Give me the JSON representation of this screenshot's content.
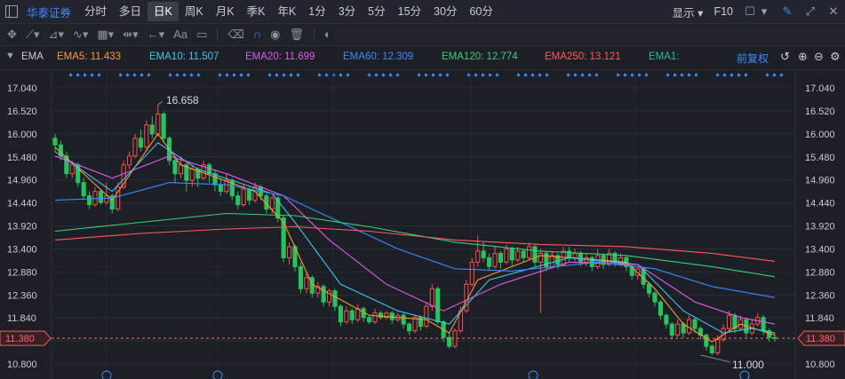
{
  "topbar": {
    "brand": "华泰证券",
    "periods": [
      "分时",
      "多日",
      "日K",
      "周K",
      "月K",
      "季K",
      "年K",
      "1分",
      "3分",
      "5分",
      "15分",
      "30分",
      "60分"
    ],
    "active_period": "日K",
    "display_label": "显示",
    "f10_label": "F10"
  },
  "toolbar": {
    "font_label": "Aa"
  },
  "ema_bar": {
    "indicator": "EMA",
    "adjust_label": "前复权",
    "items": [
      {
        "label": "EMA5: 11.433",
        "color": "#ff9a2e"
      },
      {
        "label": "EMA10: 11.507",
        "color": "#3fc6f0"
      },
      {
        "label": "EMA20: 11.699",
        "color": "#e05ce6"
      },
      {
        "label": "EMA60: 12.309",
        "color": "#3a8cff"
      },
      {
        "label": "EMA120: 12.774",
        "color": "#3ad07a"
      },
      {
        "label": "EMA250: 13.121",
        "color": "#ff5a5a"
      },
      {
        "label": "EMA1:",
        "color": "#1ec0a8"
      }
    ]
  },
  "chart_data": {
    "type": "candlestick",
    "y_ticks": [
      "17.040",
      "16.520",
      "16.000",
      "15.480",
      "14.960",
      "14.440",
      "13.920",
      "13.400",
      "12.880",
      "12.360",
      "11.840",
      "11.320",
      "10.800"
    ],
    "ylim": [
      10.8,
      17.04
    ],
    "current_price": "11.380",
    "high_label": "16.658",
    "low_label": "11.000",
    "grid": true,
    "candles": [
      [
        15.9,
        15.75,
        16.0,
        15.6
      ],
      [
        15.75,
        15.5,
        15.85,
        15.4
      ],
      [
        15.5,
        15.1,
        15.6,
        15.0
      ],
      [
        15.1,
        15.3,
        15.4,
        15.0
      ],
      [
        15.3,
        14.9,
        15.35,
        14.8
      ],
      [
        14.9,
        14.6,
        15.0,
        14.5
      ],
      [
        14.6,
        14.4,
        14.7,
        14.3
      ],
      [
        14.4,
        14.7,
        14.8,
        14.35
      ],
      [
        14.7,
        14.45,
        14.75,
        14.4
      ],
      [
        14.45,
        14.6,
        14.9,
        14.4
      ],
      [
        14.6,
        14.3,
        14.65,
        14.2
      ],
      [
        14.3,
        14.8,
        14.9,
        14.25
      ],
      [
        14.8,
        15.3,
        15.4,
        14.75
      ],
      [
        15.3,
        15.5,
        15.6,
        15.2
      ],
      [
        15.5,
        15.9,
        16.0,
        15.45
      ],
      [
        15.9,
        15.7,
        16.1,
        15.6
      ],
      [
        15.7,
        16.2,
        16.3,
        15.65
      ],
      [
        16.2,
        16.0,
        16.4,
        15.9
      ],
      [
        16.0,
        16.45,
        16.658,
        15.95
      ],
      [
        16.45,
        15.9,
        16.5,
        15.8
      ],
      [
        15.9,
        15.4,
        15.95,
        15.3
      ],
      [
        15.4,
        15.1,
        15.5,
        14.9
      ],
      [
        15.1,
        15.3,
        15.5,
        15.0
      ],
      [
        15.3,
        14.95,
        15.35,
        14.7
      ],
      [
        14.95,
        15.2,
        15.3,
        14.8
      ],
      [
        15.2,
        15.0,
        15.25,
        14.8
      ],
      [
        15.0,
        15.3,
        15.4,
        14.95
      ],
      [
        15.3,
        15.1,
        15.35,
        14.9
      ],
      [
        15.1,
        14.85,
        15.2,
        14.7
      ],
      [
        14.85,
        14.7,
        15.0,
        14.6
      ],
      [
        14.7,
        14.95,
        15.1,
        14.65
      ],
      [
        14.95,
        14.6,
        15.0,
        14.5
      ],
      [
        14.6,
        14.4,
        14.7,
        14.3
      ],
      [
        14.4,
        14.75,
        14.85,
        14.35
      ],
      [
        14.75,
        14.5,
        14.8,
        14.4
      ],
      [
        14.5,
        14.8,
        14.9,
        14.45
      ],
      [
        14.8,
        14.6,
        14.85,
        14.5
      ],
      [
        14.6,
        14.3,
        14.65,
        14.2
      ],
      [
        14.3,
        14.55,
        14.6,
        14.2
      ],
      [
        14.55,
        14.1,
        14.6,
        14.0
      ],
      [
        14.1,
        13.2,
        14.15,
        13.1
      ],
      [
        13.2,
        13.45,
        13.55,
        13.05
      ],
      [
        13.45,
        13.0,
        13.5,
        12.9
      ],
      [
        13.0,
        12.5,
        13.1,
        12.4
      ],
      [
        12.5,
        12.75,
        12.85,
        12.4
      ],
      [
        12.75,
        12.4,
        12.8,
        12.3
      ],
      [
        12.4,
        12.55,
        12.65,
        12.3
      ],
      [
        12.55,
        12.2,
        12.6,
        12.1
      ],
      [
        12.2,
        12.45,
        12.5,
        12.1
      ],
      [
        12.45,
        12.1,
        12.5,
        12.0
      ],
      [
        12.1,
        11.75,
        12.15,
        11.65
      ],
      [
        11.75,
        12.0,
        12.1,
        11.7
      ],
      [
        12.0,
        11.8,
        12.05,
        11.7
      ],
      [
        11.8,
        12.05,
        12.15,
        11.75
      ],
      [
        12.05,
        11.85,
        12.1,
        11.75
      ],
      [
        11.85,
        11.75,
        11.9,
        11.7
      ],
      [
        11.75,
        11.95,
        12.05,
        11.7
      ],
      [
        11.95,
        11.85,
        12.0,
        11.8
      ],
      [
        11.85,
        11.95,
        12.0,
        11.8
      ],
      [
        11.95,
        11.8,
        12.0,
        11.7
      ],
      [
        11.8,
        11.9,
        11.95,
        11.75
      ],
      [
        11.9,
        11.7,
        11.95,
        11.6
      ],
      [
        11.7,
        11.55,
        11.75,
        11.45
      ],
      [
        11.55,
        11.85,
        11.9,
        11.5
      ],
      [
        11.85,
        11.65,
        11.9,
        11.55
      ],
      [
        11.65,
        12.1,
        12.2,
        11.6
      ],
      [
        12.1,
        12.5,
        12.6,
        12.0
      ],
      [
        12.5,
        11.75,
        12.55,
        11.7
      ],
      [
        11.75,
        11.4,
        11.8,
        11.3
      ],
      [
        11.4,
        11.2,
        11.5,
        11.15
      ],
      [
        11.2,
        11.55,
        11.6,
        11.15
      ],
      [
        11.55,
        12.0,
        12.1,
        11.5
      ],
      [
        12.0,
        12.6,
        12.7,
        11.95
      ],
      [
        12.6,
        13.1,
        13.2,
        12.55
      ],
      [
        13.1,
        13.35,
        13.7,
        13.0
      ],
      [
        13.35,
        13.2,
        13.55,
        13.1
      ],
      [
        13.2,
        13.0,
        13.3,
        12.9
      ],
      [
        13.0,
        13.3,
        13.45,
        12.95
      ],
      [
        13.3,
        13.1,
        13.35,
        12.95
      ],
      [
        13.1,
        13.4,
        13.5,
        13.05
      ],
      [
        13.4,
        13.15,
        13.45,
        13.0
      ],
      [
        13.15,
        13.35,
        13.45,
        13.1
      ],
      [
        13.35,
        13.2,
        13.4,
        13.1
      ],
      [
        13.2,
        13.45,
        13.55,
        13.15
      ],
      [
        13.45,
        13.1,
        13.5,
        13.0
      ],
      [
        13.1,
        13.3,
        13.4,
        11.95
      ],
      [
        13.3,
        13.0,
        13.35,
        12.9
      ],
      [
        13.0,
        13.25,
        13.35,
        12.95
      ],
      [
        13.25,
        13.05,
        13.3,
        12.95
      ],
      [
        13.05,
        13.35,
        13.45,
        13.0
      ],
      [
        13.35,
        13.2,
        13.45,
        13.1
      ],
      [
        13.2,
        13.3,
        13.4,
        13.1
      ],
      [
        13.3,
        13.1,
        13.35,
        13.0
      ],
      [
        13.1,
        13.2,
        13.3,
        13.0
      ],
      [
        13.2,
        13.0,
        13.25,
        12.9
      ],
      [
        13.0,
        13.25,
        13.4,
        12.95
      ],
      [
        13.25,
        13.05,
        13.3,
        12.95
      ],
      [
        13.05,
        13.3,
        13.4,
        13.0
      ],
      [
        13.3,
        13.1,
        13.35,
        13.0
      ],
      [
        13.1,
        13.2,
        13.3,
        13.0
      ],
      [
        13.2,
        13.0,
        13.25,
        12.9
      ],
      [
        13.0,
        12.8,
        13.05,
        12.7
      ],
      [
        12.8,
        12.95,
        13.0,
        12.7
      ],
      [
        12.95,
        12.6,
        13.0,
        12.5
      ],
      [
        12.6,
        12.4,
        12.65,
        12.3
      ],
      [
        12.4,
        12.2,
        12.45,
        12.1
      ],
      [
        12.2,
        11.9,
        12.25,
        11.8
      ],
      [
        11.9,
        11.7,
        11.95,
        11.6
      ],
      [
        11.7,
        11.45,
        11.75,
        11.35
      ],
      [
        11.45,
        11.7,
        11.8,
        11.4
      ],
      [
        11.7,
        11.5,
        11.75,
        11.4
      ],
      [
        11.5,
        11.8,
        11.9,
        11.45
      ],
      [
        11.8,
        11.6,
        11.85,
        11.5
      ],
      [
        11.6,
        11.45,
        11.65,
        11.35
      ],
      [
        11.45,
        11.2,
        11.5,
        11.1
      ],
      [
        11.2,
        11.05,
        11.25,
        11.0
      ],
      [
        11.05,
        11.35,
        11.45,
        11.0
      ],
      [
        11.35,
        11.6,
        11.7,
        11.3
      ],
      [
        11.6,
        11.9,
        12.0,
        11.55
      ],
      [
        11.9,
        11.6,
        11.95,
        11.5
      ],
      [
        11.6,
        11.8,
        11.9,
        11.55
      ],
      [
        11.8,
        11.5,
        11.85,
        11.4
      ],
      [
        11.5,
        11.7,
        11.8,
        11.45
      ],
      [
        11.7,
        11.85,
        11.95,
        11.65
      ],
      [
        11.85,
        11.55,
        11.9,
        11.45
      ],
      [
        11.55,
        11.4,
        11.6,
        11.3
      ],
      [
        11.4,
        11.38,
        11.5,
        11.3
      ]
    ],
    "ema": [
      {
        "name": "EMA5",
        "color": "#ff9a2e",
        "points": [
          [
            0,
            15.7
          ],
          [
            10,
            14.5
          ],
          [
            18,
            16.0
          ],
          [
            22,
            15.3
          ],
          [
            35,
            14.7
          ],
          [
            40,
            14.0
          ],
          [
            45,
            12.6
          ],
          [
            55,
            11.9
          ],
          [
            65,
            11.8
          ],
          [
            69,
            11.5
          ],
          [
            74,
            12.7
          ],
          [
            85,
            13.25
          ],
          [
            100,
            13.1
          ],
          [
            105,
            12.5
          ],
          [
            110,
            11.7
          ],
          [
            115,
            11.3
          ],
          [
            120,
            11.7
          ],
          [
            126,
            11.45
          ]
        ]
      },
      {
        "name": "EMA10",
        "color": "#3fc6f0",
        "points": [
          [
            0,
            15.6
          ],
          [
            10,
            14.7
          ],
          [
            18,
            15.8
          ],
          [
            25,
            15.2
          ],
          [
            38,
            14.65
          ],
          [
            42,
            14.0
          ],
          [
            50,
            12.6
          ],
          [
            60,
            12.0
          ],
          [
            69,
            11.7
          ],
          [
            76,
            12.7
          ],
          [
            90,
            13.2
          ],
          [
            102,
            13.05
          ],
          [
            110,
            12.0
          ],
          [
            117,
            11.5
          ],
          [
            122,
            11.6
          ],
          [
            126,
            11.5
          ]
        ]
      },
      {
        "name": "EMA20",
        "color": "#e05ce6",
        "points": [
          [
            0,
            15.5
          ],
          [
            10,
            15.0
          ],
          [
            20,
            15.5
          ],
          [
            30,
            15.1
          ],
          [
            40,
            14.6
          ],
          [
            48,
            13.6
          ],
          [
            58,
            12.6
          ],
          [
            68,
            12.0
          ],
          [
            78,
            12.6
          ],
          [
            90,
            13.1
          ],
          [
            102,
            13.05
          ],
          [
            112,
            12.2
          ],
          [
            120,
            11.85
          ],
          [
            126,
            11.7
          ]
        ]
      },
      {
        "name": "EMA60",
        "color": "#3a8cff",
        "points": [
          [
            0,
            14.5
          ],
          [
            10,
            14.55
          ],
          [
            20,
            14.9
          ],
          [
            30,
            14.85
          ],
          [
            40,
            14.6
          ],
          [
            50,
            14.0
          ],
          [
            60,
            13.4
          ],
          [
            70,
            12.95
          ],
          [
            80,
            12.9
          ],
          [
            95,
            13.1
          ],
          [
            105,
            12.95
          ],
          [
            115,
            12.55
          ],
          [
            126,
            12.3
          ]
        ]
      },
      {
        "name": "EMA120",
        "color": "#3ad07a",
        "points": [
          [
            0,
            13.8
          ],
          [
            15,
            14.0
          ],
          [
            30,
            14.2
          ],
          [
            42,
            14.15
          ],
          [
            55,
            13.9
          ],
          [
            70,
            13.55
          ],
          [
            85,
            13.35
          ],
          [
            100,
            13.25
          ],
          [
            115,
            13.0
          ],
          [
            126,
            12.77
          ]
        ]
      },
      {
        "name": "EMA250",
        "color": "#ff5a5a",
        "points": [
          [
            0,
            13.6
          ],
          [
            15,
            13.75
          ],
          [
            30,
            13.85
          ],
          [
            42,
            13.9
          ],
          [
            55,
            13.8
          ],
          [
            70,
            13.6
          ],
          [
            85,
            13.5
          ],
          [
            100,
            13.45
          ],
          [
            115,
            13.3
          ],
          [
            126,
            13.12
          ]
        ]
      }
    ]
  }
}
